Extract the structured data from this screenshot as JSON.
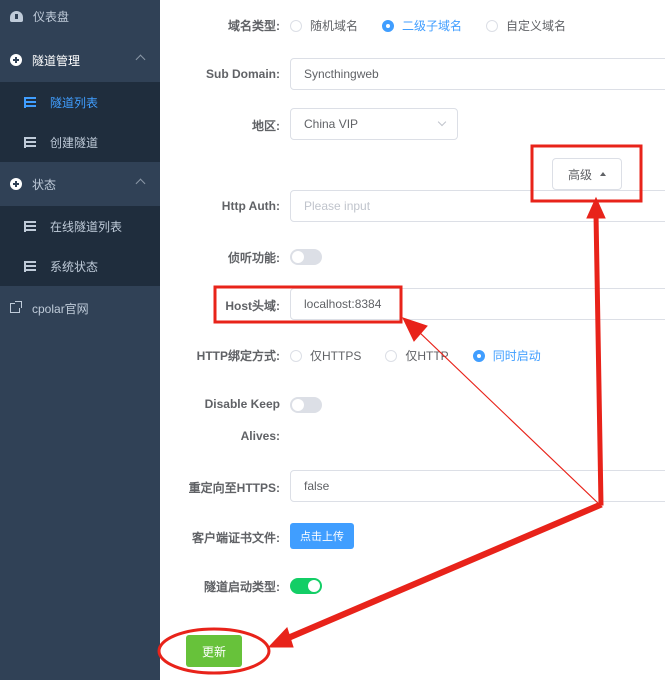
{
  "sidebar": {
    "dashboard": "仪表盘",
    "tunnel_mgmt": "隧道管理",
    "tunnel_list": "隧道列表",
    "create_tunnel": "创建隧道",
    "status": "状态",
    "online_tunnels": "在线隧道列表",
    "system_status": "系统状态",
    "cpolar_site": "cpolar官网"
  },
  "form": {
    "domain_type_label": "域名类型:",
    "domain_type_options": [
      "随机域名",
      "二级子域名",
      "自定义域名"
    ],
    "domain_type_selected": "二级子域名",
    "subdomain_label": "Sub Domain:",
    "subdomain_value": "Syncthingweb",
    "region_label": "地区:",
    "region_value": "China VIP",
    "advanced_button": "高级",
    "http_auth_label": "Http Auth:",
    "http_auth_placeholder": "Please input",
    "listen_label": "侦听功能:",
    "listen_enabled": false,
    "host_label": "Host头域:",
    "host_value": "localhost:8384",
    "http_bind_label": "HTTP绑定方式:",
    "http_bind_options": [
      "仅HTTPS",
      "仅HTTP",
      "同时启动"
    ],
    "http_bind_selected": "同时启动",
    "disable_keep_label_1": "Disable Keep",
    "disable_keep_label_2": "Alives:",
    "disable_keep_enabled": false,
    "redirect_label": "重定向至HTTPS:",
    "redirect_value": "false",
    "cert_label": "客户端证书文件:",
    "upload_button": "点击上传",
    "start_type_label": "隧道启动类型:",
    "start_type_enabled": true,
    "update_button": "更新"
  },
  "colors": {
    "sidebar_bg": "#304156",
    "submenu_bg": "#1f2d3d",
    "accent": "#409eff",
    "success": "#67c23a",
    "switch_on": "#13ce66",
    "annotation": "#e8231a"
  }
}
